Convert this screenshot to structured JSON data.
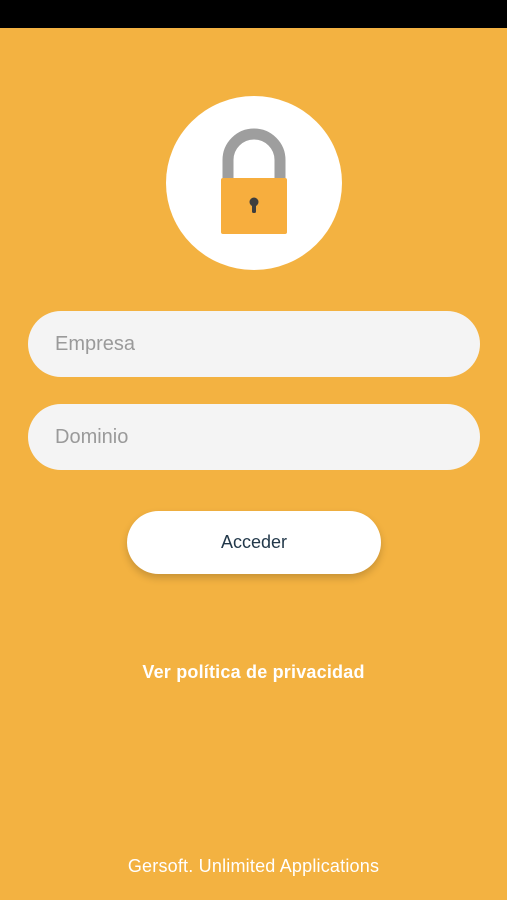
{
  "login": {
    "company_placeholder": "Empresa",
    "company_value": "",
    "domain_placeholder": "Dominio",
    "domain_value": "",
    "submit_label": "Acceder",
    "privacy_link": "Ver política de privacidad"
  },
  "footer": {
    "text": "Gersoft. Unlimited Applications"
  },
  "icons": {
    "logo": "lock-icon"
  },
  "colors": {
    "background": "#F3B241",
    "lock_body": "#F7AE3E",
    "lock_shackle": "#9E9E9E",
    "button_text": "#22384A",
    "field_background": "#F4F4F4"
  }
}
